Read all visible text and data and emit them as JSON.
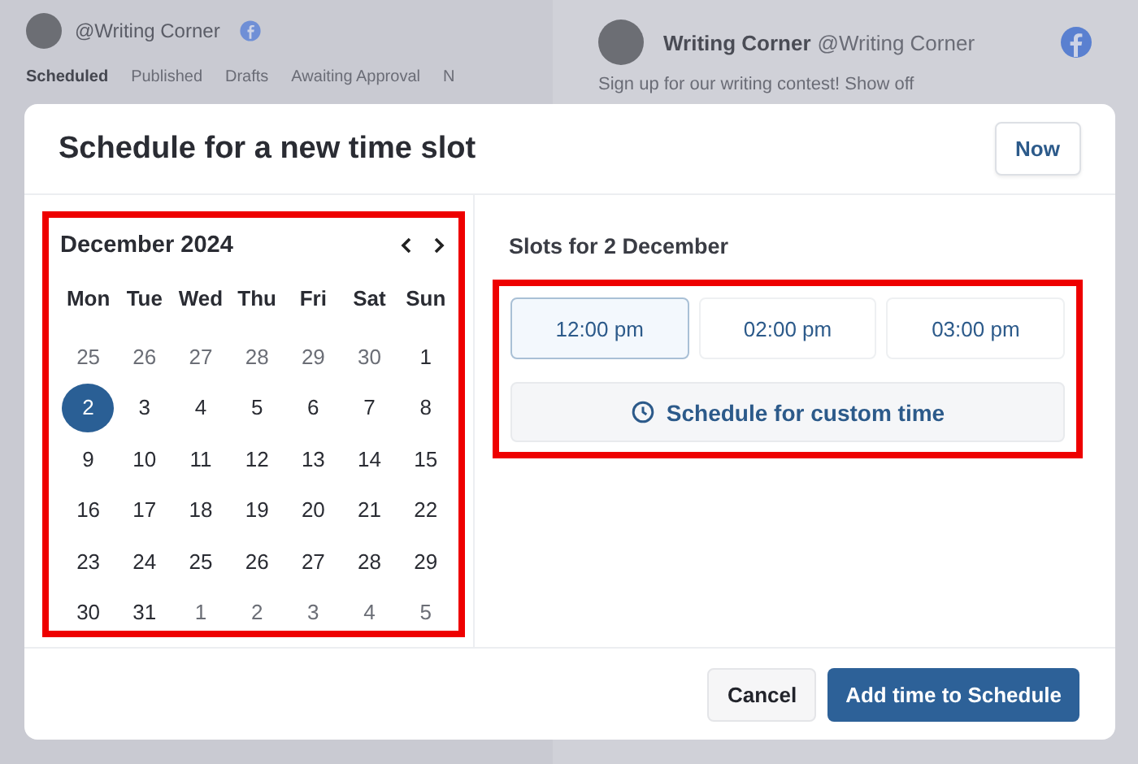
{
  "background": {
    "account": {
      "handle": "@Writing Corner"
    },
    "tabs": [
      {
        "label": "Scheduled",
        "selected": true
      },
      {
        "label": "Published",
        "selected": false
      },
      {
        "label": "Drafts",
        "selected": false
      },
      {
        "label": "Awaiting Approval",
        "selected": false
      },
      {
        "label": "N",
        "selected": false
      }
    ],
    "post": {
      "name": "Writing Corner",
      "handle": "@Writing Corner",
      "text": "Sign up for our writing contest! Show off"
    }
  },
  "dialog": {
    "title": "Schedule for a new time slot",
    "now_button": "Now",
    "calendar": {
      "month": "December 2024",
      "weekdays": [
        "Mon",
        "Tue",
        "Wed",
        "Thu",
        "Fri",
        "Sat",
        "Sun"
      ],
      "weeks": [
        [
          {
            "day": "25",
            "in_month": false,
            "selected": false
          },
          {
            "day": "26",
            "in_month": false,
            "selected": false
          },
          {
            "day": "27",
            "in_month": false,
            "selected": false
          },
          {
            "day": "28",
            "in_month": false,
            "selected": false
          },
          {
            "day": "29",
            "in_month": false,
            "selected": false
          },
          {
            "day": "30",
            "in_month": false,
            "selected": false
          },
          {
            "day": "1",
            "in_month": true,
            "selected": false
          }
        ],
        [
          {
            "day": "2",
            "in_month": true,
            "selected": true
          },
          {
            "day": "3",
            "in_month": true,
            "selected": false
          },
          {
            "day": "4",
            "in_month": true,
            "selected": false
          },
          {
            "day": "5",
            "in_month": true,
            "selected": false
          },
          {
            "day": "6",
            "in_month": true,
            "selected": false
          },
          {
            "day": "7",
            "in_month": true,
            "selected": false
          },
          {
            "day": "8",
            "in_month": true,
            "selected": false
          }
        ],
        [
          {
            "day": "9",
            "in_month": true,
            "selected": false
          },
          {
            "day": "10",
            "in_month": true,
            "selected": false
          },
          {
            "day": "11",
            "in_month": true,
            "selected": false
          },
          {
            "day": "12",
            "in_month": true,
            "selected": false
          },
          {
            "day": "13",
            "in_month": true,
            "selected": false
          },
          {
            "day": "14",
            "in_month": true,
            "selected": false
          },
          {
            "day": "15",
            "in_month": true,
            "selected": false
          }
        ],
        [
          {
            "day": "16",
            "in_month": true,
            "selected": false
          },
          {
            "day": "17",
            "in_month": true,
            "selected": false
          },
          {
            "day": "18",
            "in_month": true,
            "selected": false
          },
          {
            "day": "19",
            "in_month": true,
            "selected": false
          },
          {
            "day": "20",
            "in_month": true,
            "selected": false
          },
          {
            "day": "21",
            "in_month": true,
            "selected": false
          },
          {
            "day": "22",
            "in_month": true,
            "selected": false
          }
        ],
        [
          {
            "day": "23",
            "in_month": true,
            "selected": false
          },
          {
            "day": "24",
            "in_month": true,
            "selected": false
          },
          {
            "day": "25",
            "in_month": true,
            "selected": false
          },
          {
            "day": "26",
            "in_month": true,
            "selected": false
          },
          {
            "day": "27",
            "in_month": true,
            "selected": false
          },
          {
            "day": "28",
            "in_month": true,
            "selected": false
          },
          {
            "day": "29",
            "in_month": true,
            "selected": false
          }
        ],
        [
          {
            "day": "30",
            "in_month": true,
            "selected": false
          },
          {
            "day": "31",
            "in_month": true,
            "selected": false
          },
          {
            "day": "1",
            "in_month": false,
            "selected": false
          },
          {
            "day": "2",
            "in_month": false,
            "selected": false
          },
          {
            "day": "3",
            "in_month": false,
            "selected": false
          },
          {
            "day": "4",
            "in_month": false,
            "selected": false
          },
          {
            "day": "5",
            "in_month": false,
            "selected": false
          }
        ]
      ]
    },
    "slots": {
      "heading": "Slots for 2 December",
      "times": [
        {
          "label": "12:00 pm",
          "selected": true
        },
        {
          "label": "02:00 pm",
          "selected": false
        },
        {
          "label": "03:00 pm",
          "selected": false
        }
      ],
      "custom_button": "Schedule for custom time"
    },
    "cancel_button": "Cancel",
    "confirm_button": "Add time to Schedule"
  }
}
